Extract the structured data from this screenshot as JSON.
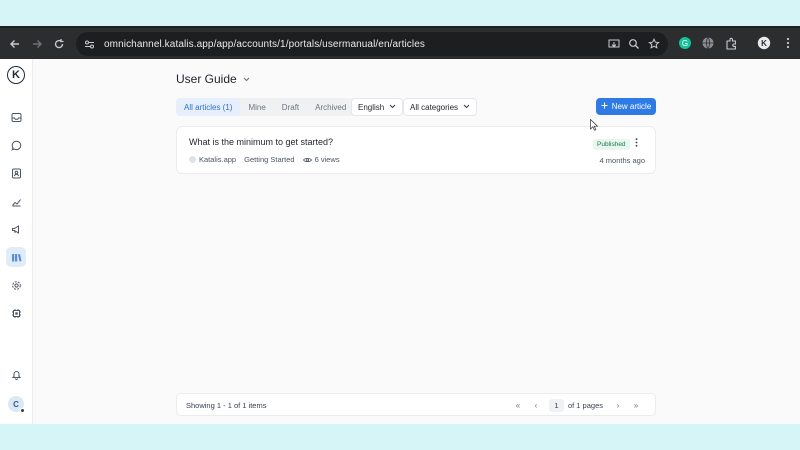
{
  "browser": {
    "url": "omnichannel.katalis.app/app/accounts/1/portals/usermanual/en/articles"
  },
  "sidebar": {
    "logo_letter": "K",
    "items": [
      {
        "icon": "inbox-icon"
      },
      {
        "icon": "conversation-icon"
      },
      {
        "icon": "contacts-icon"
      },
      {
        "icon": "reports-icon"
      },
      {
        "icon": "campaigns-icon"
      },
      {
        "icon": "help-center-icon",
        "active": true
      },
      {
        "icon": "settings-icon"
      },
      {
        "icon": "integrations-icon"
      }
    ],
    "notifications_icon": "bell-icon",
    "avatar_letter": "C"
  },
  "header": {
    "portal_title": "User Guide"
  },
  "filters": {
    "tabs": [
      {
        "label": "All articles (1)",
        "active": true
      },
      {
        "label": "Mine"
      },
      {
        "label": "Draft"
      },
      {
        "label": "Archived"
      }
    ],
    "locale": "English",
    "category": "All categories",
    "new_article_label": "New article"
  },
  "articles": [
    {
      "title": "What is the minimum to get started?",
      "status": "Published",
      "author": "Katalis.app",
      "category": "Getting Started",
      "views": "6 views",
      "updated": "4 months ago"
    }
  ],
  "pagination": {
    "showing": "Showing 1 - 1 of 1 items",
    "current_page": "1",
    "of_pages": "of 1 pages"
  },
  "colors": {
    "accent": "#2f7be5",
    "published_bg": "#e7f6ee",
    "published_text": "#1d7a4a"
  }
}
